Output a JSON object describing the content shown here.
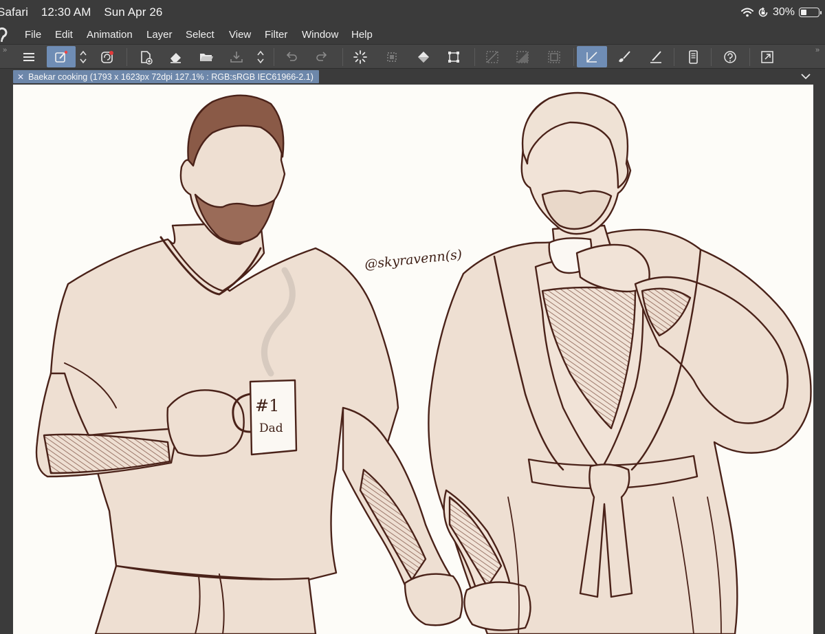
{
  "status_bar": {
    "app": "Safari",
    "time": "12:30 AM",
    "date": "Sun Apr 26",
    "battery": "30%",
    "battery_level": 0.3,
    "icons": [
      "wifi-icon",
      "orientation-lock-icon",
      "battery-icon"
    ]
  },
  "menu": {
    "items": [
      "File",
      "Edit",
      "Animation",
      "Layer",
      "Select",
      "View",
      "Filter",
      "Window",
      "Help"
    ]
  },
  "toolbar": {
    "accent_color": "#6f8db5",
    "tools": [
      "hamburger-menu-icon",
      "quick-access-icon",
      "stepper-icon",
      "sync-icon",
      "new-layer-icon",
      "eraser-icon",
      "open-file-icon",
      "save-icon",
      "stepper-icon",
      "undo-icon",
      "redo-icon",
      "loading-icon",
      "selection-icon",
      "fill-icon",
      "transform-icon",
      "snap-off-icon",
      "snap-grid-icon",
      "snap-frame-icon",
      "ruler-snap-icon",
      "brush-icon",
      "pen-icon",
      "device-icon",
      "help-icon",
      "expand-icon"
    ]
  },
  "document_tab": {
    "title": "Baekar cooking  (1793 x 1623px 72dpi 127.1% : RGB:sRGB IEC61966-2.1)",
    "tab_color": "#6d87aa"
  },
  "artwork": {
    "signature": "@skyravenn(s)",
    "mug_line1": "#1",
    "mug_line2": "Dad",
    "line_color": "#4a2219",
    "fill_color": "#eedfd2"
  }
}
